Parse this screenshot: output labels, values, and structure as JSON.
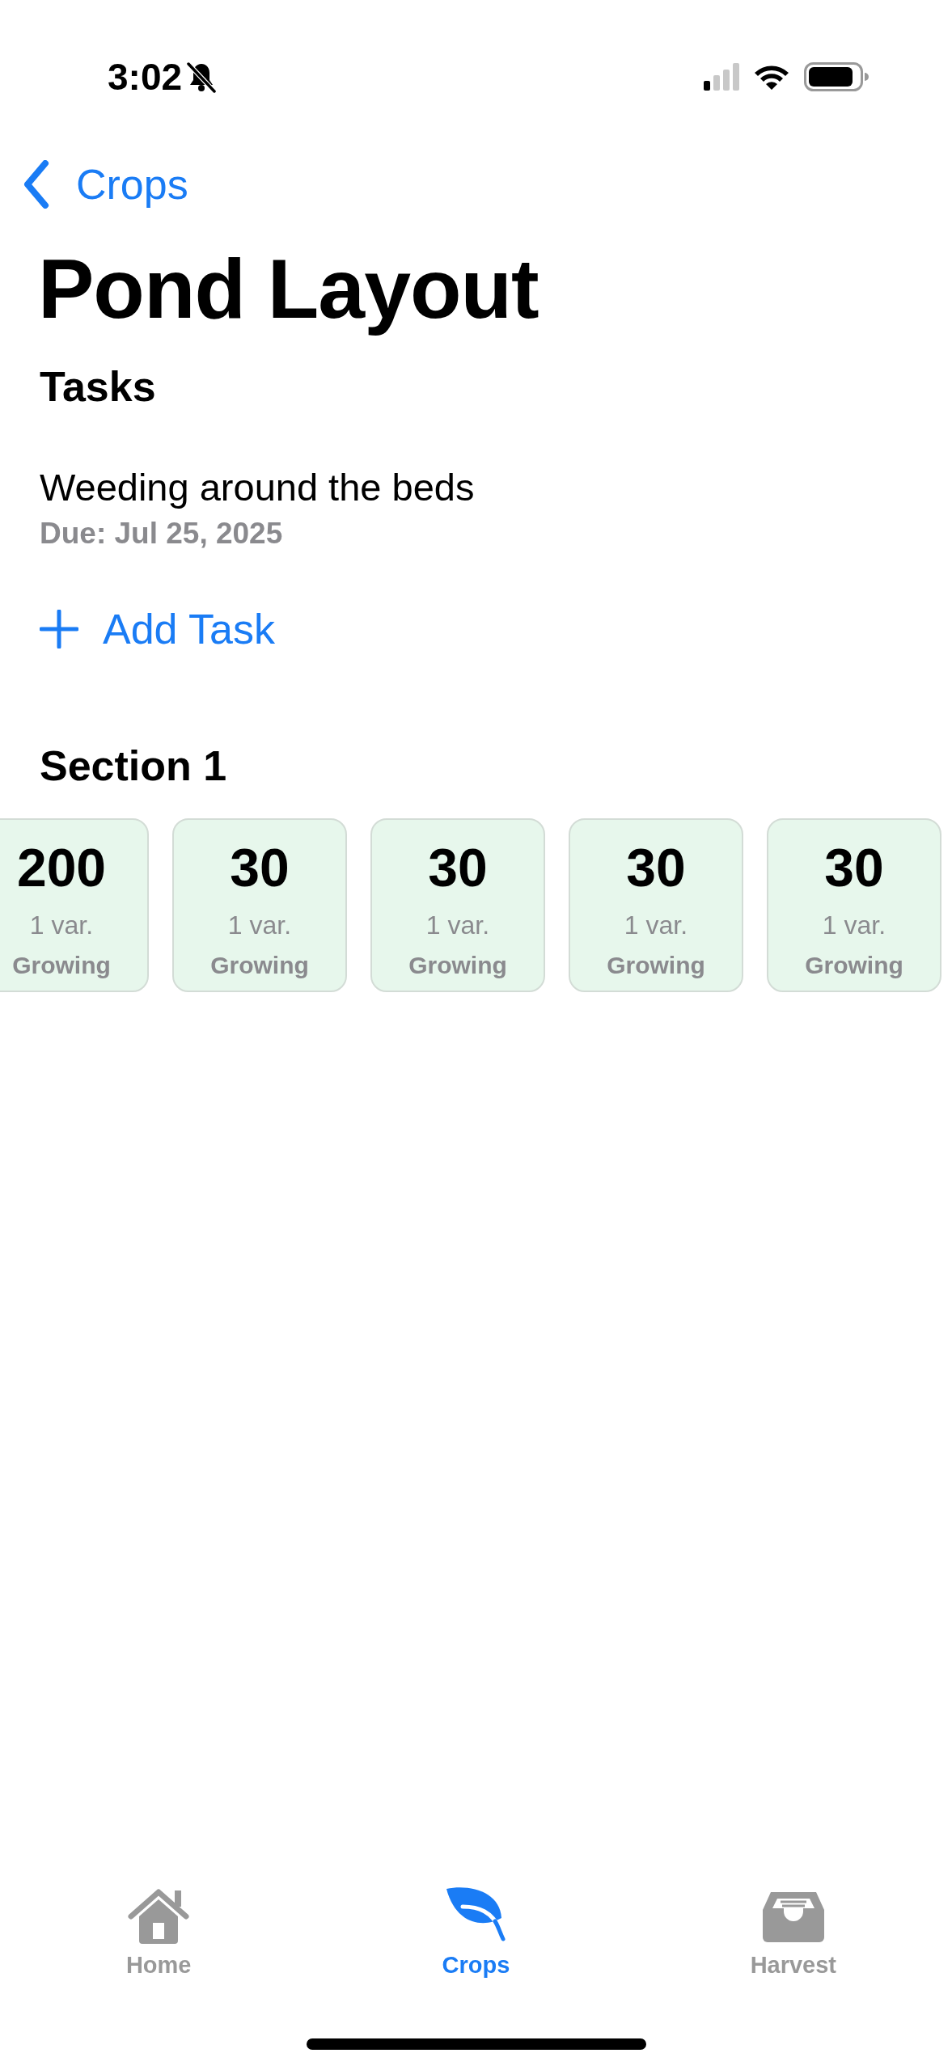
{
  "status_bar": {
    "time": "3:02",
    "silent": true
  },
  "back": {
    "label": "Crops"
  },
  "title": "Pond Layout",
  "tasks": {
    "heading": "Tasks",
    "items": [
      {
        "title": "Weeding around the beds",
        "due": "Due: Jul 25, 2025"
      }
    ],
    "add_label": "Add Task"
  },
  "sections": [
    {
      "title": "Section 1",
      "cards": [
        {
          "count": "200",
          "varieties": "1 var.",
          "status": "Growing"
        },
        {
          "count": "30",
          "varieties": "1 var.",
          "status": "Growing"
        },
        {
          "count": "30",
          "varieties": "1 var.",
          "status": "Growing"
        },
        {
          "count": "30",
          "varieties": "1 var.",
          "status": "Growing"
        },
        {
          "count": "30",
          "varieties": "1 var.",
          "status": "Growing"
        }
      ]
    }
  ],
  "tab_bar": [
    {
      "label": "Home",
      "kind": "home",
      "selected": false
    },
    {
      "label": "Crops",
      "kind": "crops",
      "selected": true
    },
    {
      "label": "Harvest",
      "kind": "harvest",
      "selected": false
    }
  ]
}
